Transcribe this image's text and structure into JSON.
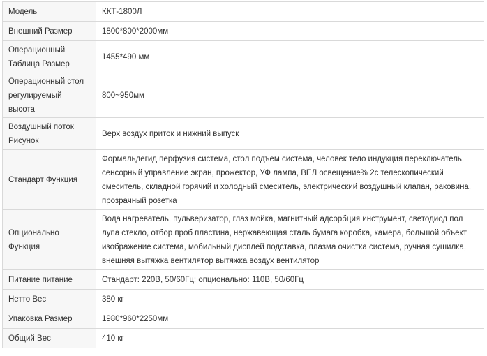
{
  "rows": [
    {
      "label": "Модель",
      "value": "ККТ-1800Л"
    },
    {
      "label": "Внешний Размер",
      "value": "1800*800*2000мм"
    },
    {
      "label": "Операционный Таблица Размер",
      "value": "1455*490 мм"
    },
    {
      "label": "Операционный стол регулируемый высота",
      "value": "800~950мм"
    },
    {
      "label": "Воздушный поток Рисунок",
      "value": "Верх воздух приток и нижний выпуск"
    },
    {
      "label": "Стандарт Функция",
      "value": "Формальдегид перфузия система, стол подъем система, человек тело индукция переключатель, сенсорный управление экран, прожектор, УФ лампа, ВЕЛ освещение% 2с телескопический смеситель, складной горячий и холодный смеситель, электрический воздушный клапан, раковина, прозрачный розетка"
    },
    {
      "label": "Опционально Функция",
      "value": "Вода нагреватель, пульверизатор, глаз мойка, магнитный адсорбция инструмент, светодиод пол лупа стекло, отбор проб пластина, нержавеющая сталь бумага коробка, камера, большой объект изображение система, мобильный дисплей подставка, плазма очистка система, ручная сушилка, внешняя вытяжка вентилятор вытяжка воздух вентилятор"
    },
    {
      "label": "Питание питание",
      "value": "Стандарт: 220В, 50/60Гц; опционально: 110В, 50/60Гц"
    },
    {
      "label": "Нетто Вес",
      "value": "380 кг"
    },
    {
      "label": "Упаковка Размер",
      "value": "1980*960*2250мм"
    },
    {
      "label": "Общий Вес",
      "value": "410 кг"
    }
  ]
}
